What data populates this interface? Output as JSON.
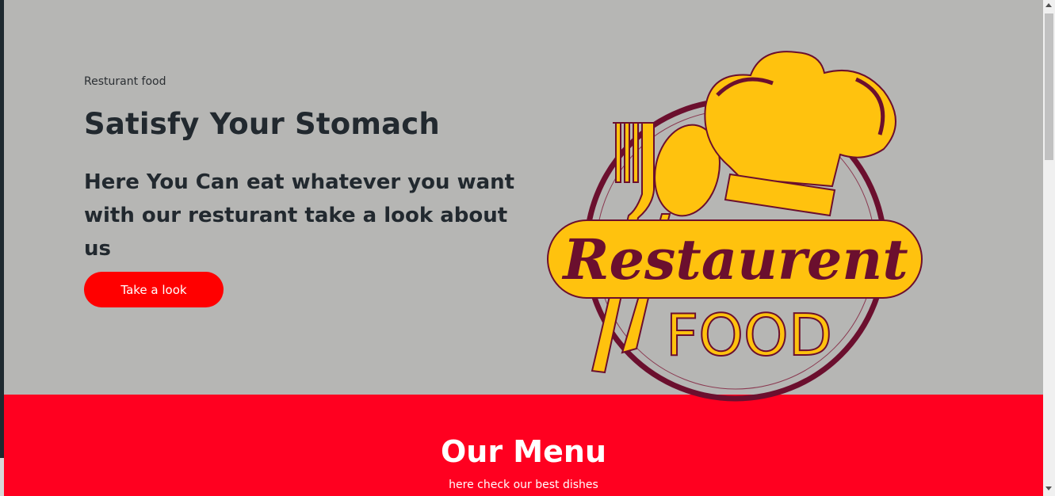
{
  "hero": {
    "eyebrow": "Resturant food",
    "title": "Satisfy Your Stomach",
    "subtitle": "Here You Can eat whatever you want with our resturant take a look about us",
    "cta_label": "Take a look"
  },
  "logo": {
    "banner_text": "Restaurent",
    "sub_text": "FOOD"
  },
  "menu": {
    "title": "Our Menu",
    "subtitle": "here check our best dishes"
  },
  "colors": {
    "hero_bg": "#b6b6b4",
    "accent_red": "#ff0000",
    "menu_bg": "#ff0020",
    "logo_yellow": "#ffc20e",
    "logo_maroon": "#6b0f2e"
  }
}
